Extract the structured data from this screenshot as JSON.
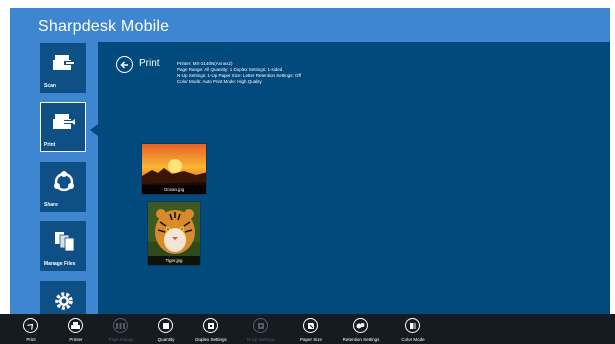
{
  "app": {
    "title": "Sharpdesk Mobile"
  },
  "sidebar": {
    "items": [
      {
        "label": "Scan",
        "icon": "scan-icon",
        "selected": false
      },
      {
        "label": "Print",
        "icon": "print-icon",
        "selected": true
      },
      {
        "label": "Share",
        "icon": "share-icon",
        "selected": false
      },
      {
        "label": "Manage Files",
        "icon": "manage-files-icon",
        "selected": false
      },
      {
        "label": "",
        "icon": "settings-icon",
        "selected": false
      }
    ]
  },
  "main": {
    "heading": "Print",
    "settings_lines": [
      "Printer: MX-3140N(Annex2)",
      "Page Range: All   Quantity: 1   Duplex Settings: 1-sided",
      "N-Up Settings: 1-Up   Paper Size: Letter   Retention Settings: Off",
      "Color Mode: Auto   Print Mode: High Quality"
    ],
    "files": [
      {
        "name": "Ocean.jpg"
      },
      {
        "name": "Tiger.jpg"
      }
    ]
  },
  "appbar": {
    "buttons": [
      {
        "label": "Print",
        "icon": "print-action-icon",
        "enabled": true
      },
      {
        "label": "Printer",
        "icon": "printer-icon",
        "enabled": true
      },
      {
        "label": "Page Range",
        "icon": "page-range-icon",
        "enabled": false
      },
      {
        "label": "Quantity",
        "icon": "quantity-icon",
        "enabled": true
      },
      {
        "label": "Duplex Settings",
        "icon": "duplex-icon",
        "enabled": true
      },
      {
        "label": "N-Up Settings",
        "icon": "n-up-icon",
        "enabled": false
      },
      {
        "label": "Paper Size",
        "icon": "paper-size-icon",
        "enabled": true
      },
      {
        "label": "Retention Settings",
        "icon": "retention-icon",
        "enabled": true
      },
      {
        "label": "Color Mode",
        "icon": "color-mode-icon",
        "enabled": true
      }
    ]
  },
  "colors": {
    "accent": "#3f86d0",
    "panel": "#02497d",
    "tile": "#0e4f86",
    "appbar": "#161b21"
  }
}
